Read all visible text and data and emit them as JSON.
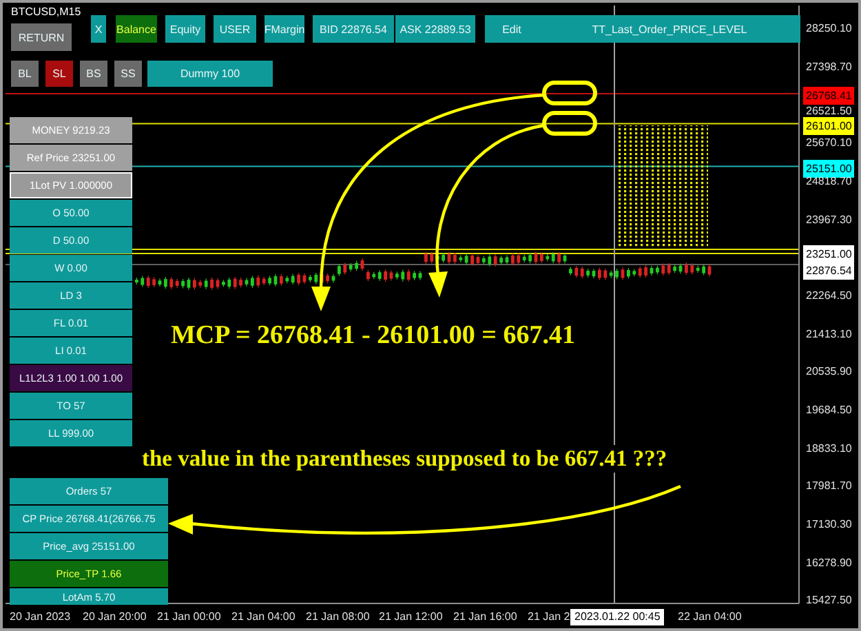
{
  "symbol": "BTCUSD,M15",
  "return_button": "RETURN",
  "toolbar": [
    {
      "label": "X",
      "kind": "teal"
    },
    {
      "label": "Balance",
      "kind": "green"
    },
    {
      "label": "Equity",
      "kind": "teal"
    },
    {
      "label": "USER",
      "kind": "teal"
    },
    {
      "label": "FMargin",
      "kind": "teal"
    },
    {
      "label": "BID 22876.54",
      "kind": "teal"
    },
    {
      "label": "ASK 22889.53",
      "kind": "teal"
    },
    {
      "label": "Edit",
      "kind": "teal"
    },
    {
      "label": "TT_Last_Order_PRICE_LEVEL",
      "kind": "teal"
    }
  ],
  "order_buttons": [
    {
      "label": "BL",
      "kind": "grey"
    },
    {
      "label": "SL",
      "kind": "red"
    },
    {
      "label": "BS",
      "kind": "grey"
    },
    {
      "label": "SS",
      "kind": "grey"
    },
    {
      "label": "Dummy  100",
      "kind": "teal"
    }
  ],
  "info_panel": [
    {
      "label": "MONEY 9219.23",
      "kind": "grey"
    },
    {
      "label": "Ref Price 23251.00",
      "kind": "grey"
    },
    {
      "label": "1Lot PV 1.000000",
      "kind": "light"
    },
    {
      "label": "O  50.00",
      "kind": "teal"
    },
    {
      "label": "D  50.00",
      "kind": "teal"
    },
    {
      "label": "W  0.00",
      "kind": "teal"
    },
    {
      "label": "LD  3",
      "kind": "teal"
    },
    {
      "label": "FL  0.01",
      "kind": "teal"
    },
    {
      "label": "LI  0.01",
      "kind": "teal"
    },
    {
      "label": "L1L2L3  1.00  1.00  1.00",
      "kind": "purple"
    },
    {
      "label": "TO  57",
      "kind": "teal"
    },
    {
      "label": "LL  999.00",
      "kind": "teal"
    }
  ],
  "order_panel": [
    {
      "label": "Orders  57",
      "kind": "teal"
    },
    {
      "label": "CP Price  26768.41(26766.75",
      "kind": "teal"
    },
    {
      "label": "Price_avg  25151.00",
      "kind": "teal"
    },
    {
      "label": "Price_TP  1.66",
      "kind": "green"
    },
    {
      "label": "LotAm  5.70",
      "kind": "teal"
    }
  ],
  "price_axis": [
    {
      "label": "28250.10",
      "kind": "tick"
    },
    {
      "label": "27398.70",
      "kind": "tick"
    },
    {
      "label": "26768.41",
      "kind": "tag",
      "color": "#ff0000"
    },
    {
      "label": "26521.50",
      "kind": "tick"
    },
    {
      "label": "26101.00",
      "kind": "tag",
      "color": "#ffff00"
    },
    {
      "label": "25670.10",
      "kind": "tick"
    },
    {
      "label": "25151.00",
      "kind": "tag",
      "color": "#00ffff"
    },
    {
      "label": "24818.70",
      "kind": "tick"
    },
    {
      "label": "23967.30",
      "kind": "tick"
    },
    {
      "label": "23251.00",
      "kind": "tag",
      "color": "#ffffff"
    },
    {
      "label": "22876.54",
      "kind": "tag",
      "color": "#ffffff"
    },
    {
      "label": "22264.50",
      "kind": "tick"
    },
    {
      "label": "21413.10",
      "kind": "tick"
    },
    {
      "label": "20535.90",
      "kind": "tick"
    },
    {
      "label": "19684.50",
      "kind": "tick"
    },
    {
      "label": "18833.10",
      "kind": "tick"
    },
    {
      "label": "17981.70",
      "kind": "tick"
    },
    {
      "label": "17130.30",
      "kind": "tick"
    },
    {
      "label": "16278.90",
      "kind": "tick"
    },
    {
      "label": "15427.50",
      "kind": "tick"
    }
  ],
  "time_axis": [
    "20 Jan 2023",
    "20 Jan 20:00",
    "21 Jan 00:00",
    "21 Jan 04:00",
    "21 Jan 08:00",
    "21 Jan 12:00",
    "21 Jan 16:00",
    "21 Jan 2",
    "22 Jan 04:00"
  ],
  "crosshair_time": "2023.01.22 00:45",
  "annotations": {
    "formula": "MCP = 26768.41 - 26101.00 = 667.41",
    "question": "the value in the parentheses supposed to be 667.41 ???"
  }
}
